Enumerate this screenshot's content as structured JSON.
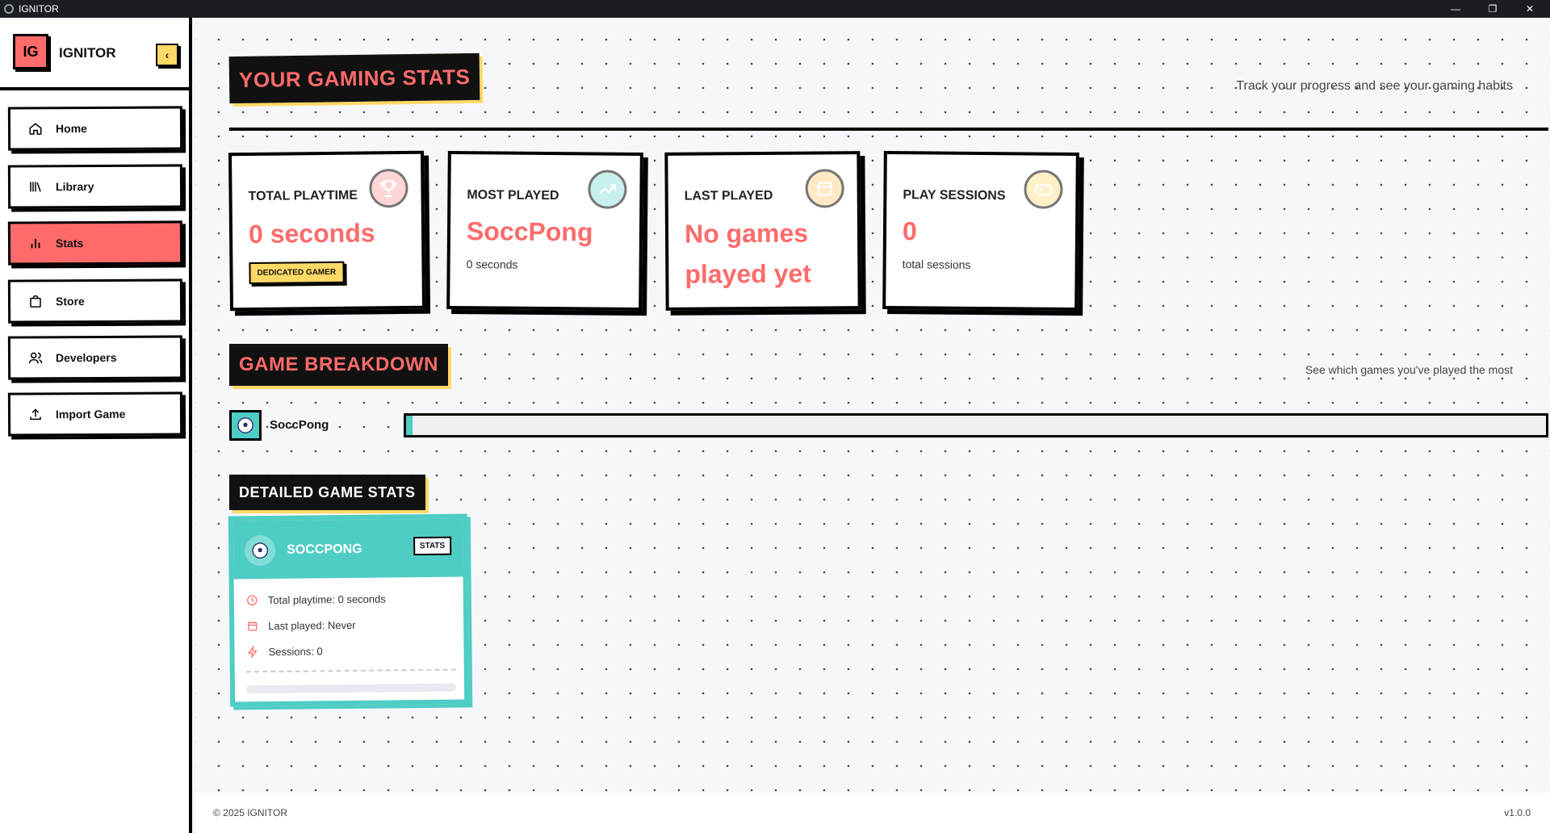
{
  "window": {
    "title": "IGNITOR",
    "minimize": "—",
    "restore": "❐",
    "close": "✕"
  },
  "sidebar": {
    "logo": "IG",
    "brand": "IGNITOR",
    "collapse_glyph": "‹",
    "items": [
      {
        "label": "Home",
        "icon": "home-icon"
      },
      {
        "label": "Library",
        "icon": "library-icon"
      },
      {
        "label": "Stats",
        "icon": "bar-chart-icon",
        "active": true
      },
      {
        "label": "Store",
        "icon": "store-icon"
      },
      {
        "label": "Developers",
        "icon": "users-icon"
      },
      {
        "label": "Import Game",
        "icon": "upload-icon"
      }
    ]
  },
  "header": {
    "title": "YOUR GAMING STATS",
    "subtitle": "Track your progress and see your gaming habits"
  },
  "stats": {
    "total_playtime": {
      "label": "TOTAL PLAYTIME",
      "value": "0 seconds",
      "badge": "DEDICATED GAMER",
      "icon": "trophy-icon"
    },
    "most_played": {
      "label": "MOST PLAYED",
      "value": "SoccPong",
      "sub": "0 seconds",
      "icon": "trending-up-icon"
    },
    "last_played": {
      "label": "LAST PLAYED",
      "value_line1": "No games",
      "value_line2": "played yet",
      "icon": "calendar-icon"
    },
    "play_sessions": {
      "label": "PLAY SESSIONS",
      "value": "0",
      "sub": "total sessions",
      "icon": "gamepad-icon"
    }
  },
  "breakdown": {
    "title": "GAME BREAKDOWN",
    "subtitle": "See which games you've played the most",
    "games": [
      {
        "name": "SoccPong",
        "share": 0.006
      }
    ]
  },
  "detailed": {
    "title": "DETAILED GAME STATS",
    "card": {
      "name": "SOCCPONG",
      "tag": "STATS",
      "playtime": "Total playtime: 0 seconds",
      "last_played": "Last played: Never",
      "sessions": "Sessions: 0"
    }
  },
  "footer": {
    "copyright": "© 2025 IGNITOR",
    "version": "v1.0.0"
  },
  "colors": {
    "accent": "#ff6b6b",
    "teal": "#4ecdc4",
    "yellow": "#ffd966",
    "ink": "#111111"
  }
}
